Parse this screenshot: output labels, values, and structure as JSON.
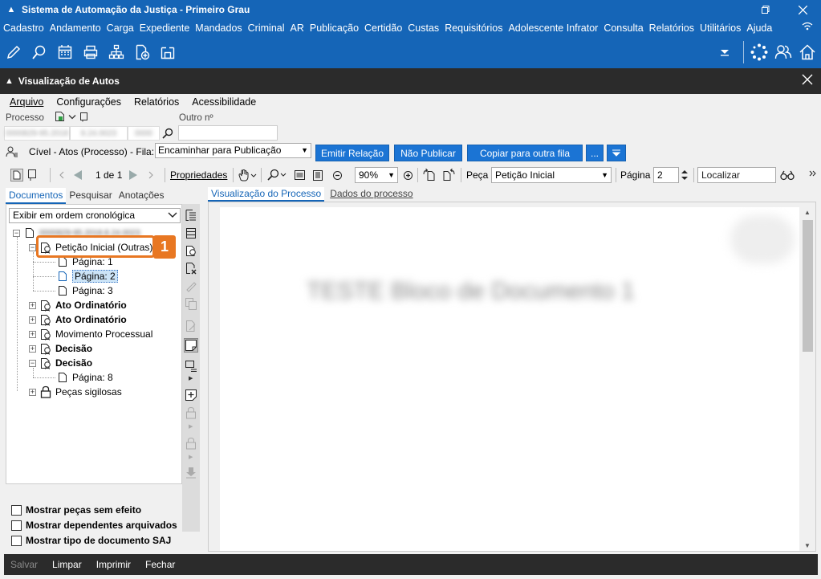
{
  "window": {
    "title": "Sistema de Automação da Justiça - Primeiro Grau"
  },
  "menu": {
    "items": [
      "Cadastro",
      "Andamento",
      "Carga",
      "Expediente",
      "Mandados",
      "Criminal",
      "AR",
      "Publicação",
      "Certidão",
      "Custas",
      "Requisitórios",
      "Adolescente Infrator",
      "Consulta",
      "Relatórios",
      "Utilitários",
      "Ajuda"
    ]
  },
  "dialog": {
    "title": "Visualização de Autos",
    "submenu": {
      "arquivo": "Arquivo",
      "configuracoes": "Configurações",
      "relatorios": "Relatórios",
      "acessibilidade": "Acessibilidade"
    },
    "processo_label": "Processo",
    "outro_label": "Outro nº",
    "processo_parts": [
      "0000829-95.2018",
      "8.24.0023",
      "0000"
    ],
    "fila_label": "Cível - Atos (Processo) - Fila:",
    "fila_value": "Encaminhar para Publicação",
    "buttons": {
      "emitir": "Emitir Relação",
      "nao_publicar": "Não Publicar",
      "copiar": "Copiar para outra fila",
      "more": "..."
    }
  },
  "viewer": {
    "page_counter": "1 de 1",
    "propriedades": "Propriedades",
    "zoom": "90%",
    "peca_label": "Peça",
    "peca_value": "Petição Inicial",
    "pagina_label": "Página",
    "pagina_value": "2",
    "localizar": "Localizar"
  },
  "left": {
    "tabs": [
      "Documentos",
      "Pesquisar",
      "Anotações"
    ],
    "order": "Exibir em ordem cronológica",
    "root_label": "0000829-95.2018.8.24.0023",
    "tree": {
      "peticao": "Petição Inicial (Outras)",
      "pag1": "Página: 1",
      "pag2": "Página: 2",
      "pag3": "Página: 3",
      "ato1": "Ato Ordinatório",
      "ato2": "Ato Ordinatório",
      "mov": "Movimento Processual",
      "dec1": "Decisão",
      "dec2": "Decisão",
      "pag8": "Página: 8",
      "sigilosas": "Peças sigilosas"
    },
    "badge": "1",
    "checks": [
      "Mostrar peças sem efeito",
      "Mostrar dependentes arquivados",
      "Mostrar tipo de documento SAJ"
    ]
  },
  "doc": {
    "tabs": [
      "Visualização do Processo",
      "Dados do processo"
    ],
    "page_title": "TESTE Bloco de Documento 1"
  },
  "footer": {
    "salvar": "Salvar",
    "limpar": "Limpar",
    "imprimir": "Imprimir",
    "fechar": "Fechar"
  },
  "colors": {
    "brand_blue": "#1565b7",
    "dark": "#2b2b2b",
    "accent_orange": "#e87722",
    "button_blue": "#1b74d4"
  }
}
